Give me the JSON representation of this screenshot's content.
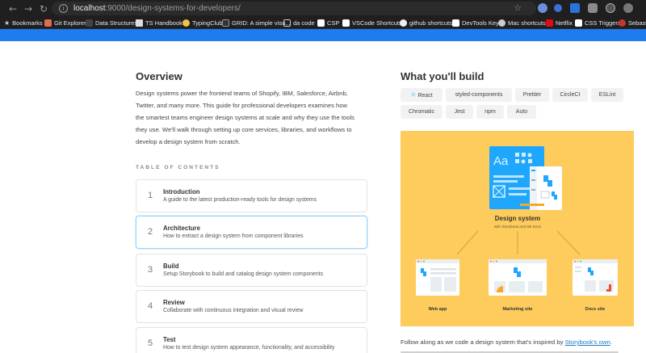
{
  "browser": {
    "url_host": "localhost",
    "url_rest": ":9000/design-systems-for-developers/",
    "bookmarks": [
      "Bookmarks",
      "Git Explorer",
      "Data Structures",
      "TS Handbook",
      "TypingClub",
      "GRID: A simple visu...",
      "da code",
      "CSP",
      "VSCode Shortcuts",
      "github shortcuts",
      "DevTools Keys",
      "Mac shortcuts",
      "Netflix",
      "CSS Triggers",
      "Sebasti"
    ]
  },
  "overview": {
    "title": "Overview",
    "lines": [
      "Design systems power the frontend teams of Shopify, IBM, Salesforce, Airbnb,",
      "Twitter, and many more. This guide for professional developers examines how",
      "the smartest teams engineer design systems at scale and why they use the tools",
      "they use. We'll walk through setting up core services, libraries, and workflows to",
      "develop a design system from scratch."
    ]
  },
  "toc": {
    "heading": "TABLE OF CONTENTS",
    "items": [
      {
        "num": "1",
        "title": "Introduction",
        "desc": "A guide to the latest production-ready tools for design systems"
      },
      {
        "num": "2",
        "title": "Architecture",
        "desc": "How to extract a design system from component libraries"
      },
      {
        "num": "3",
        "title": "Build",
        "desc": "Setup Storybook to build and catalog design system components"
      },
      {
        "num": "4",
        "title": "Review",
        "desc": "Collaborate with continuous integration and visual review"
      },
      {
        "num": "5",
        "title": "Test",
        "desc": "How to test design system appearance, functionality, and accessibility"
      }
    ]
  },
  "build": {
    "title": "What you'll build",
    "tags": [
      "React",
      "styled-components",
      "Prettier",
      "CircleCI",
      "ESLint",
      "Chromatic",
      "Jest",
      "npm",
      "Auto"
    ],
    "illustration": {
      "headline": "Design system",
      "subline": "with Storybook and SB Docs",
      "aa": "Aa",
      "sites": [
        "Web app",
        "Marketing site",
        "Docs site"
      ]
    },
    "follow_prefix": "Follow along as we code a design system that's inspired by ",
    "follow_link": "Storybook's own",
    "follow_suffix": "."
  },
  "colors": {
    "browser_bg": "#1f1f1f",
    "blue_strip": "#1e7bf0",
    "illustration_bg": "#fdcc5c",
    "storybook_blue": "#1ea7fd"
  }
}
